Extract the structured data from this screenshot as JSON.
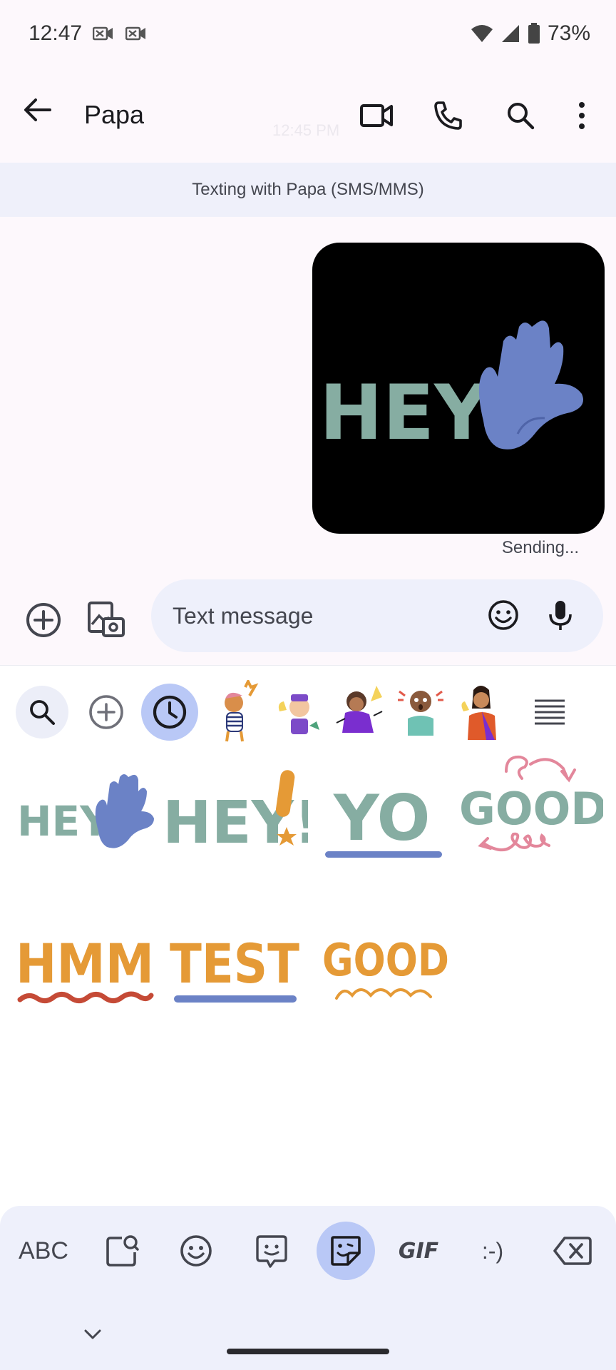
{
  "status_bar": {
    "time": "12:47",
    "battery": "73%"
  },
  "app_bar": {
    "contact_name": "Papa",
    "ghost_time": "12:45 PM"
  },
  "banner": {
    "text": "Texting with Papa (SMS/MMS)"
  },
  "message": {
    "sticker_text": "HEY",
    "status": "Sending..."
  },
  "compose": {
    "placeholder": "Text message"
  },
  "sticker_grid": {
    "row1": [
      "HEY",
      "HEY!",
      "YO",
      "GOOD"
    ],
    "row2": [
      "HMM",
      "TEST",
      "GOOD"
    ]
  },
  "keyboard_tabs": {
    "abc": "ABC",
    "gif": "GIF",
    "emoticon": ":-)"
  },
  "colors": {
    "accent": "#b9c8f6",
    "sticker_green": "#86ada2",
    "sticker_blue": "#6b82c6",
    "sticker_orange": "#e59a36",
    "sticker_pink": "#e3879b"
  }
}
